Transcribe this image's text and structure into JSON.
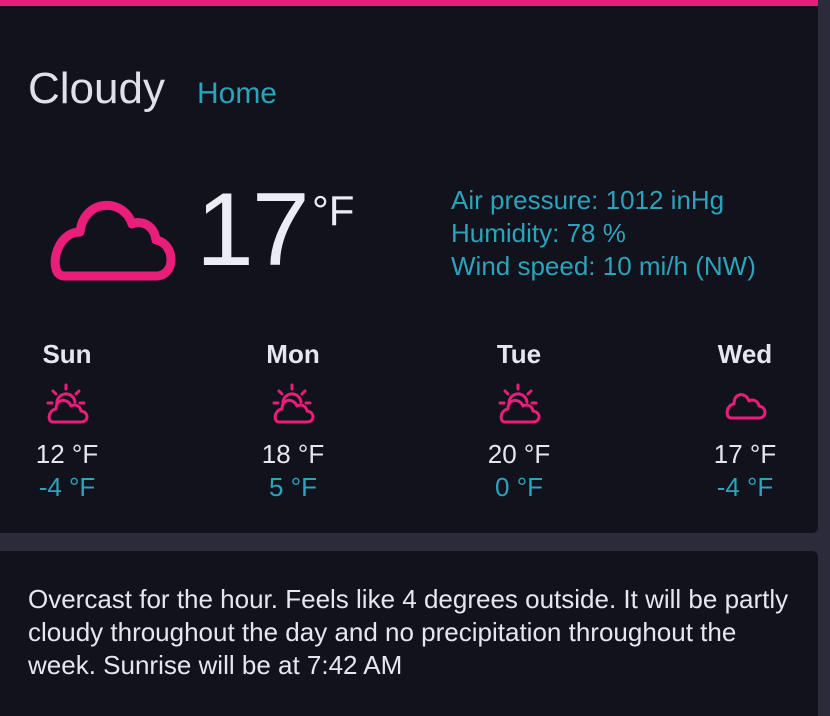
{
  "current": {
    "condition": "Cloudy",
    "location": "Home",
    "temperature": "17",
    "unit": "°F",
    "icon": "cloud-icon",
    "air_pressure": "Air pressure: 1012 inHg",
    "humidity": "Humidity: 78 %",
    "wind_speed": "Wind speed: 10 mi/h (NW)"
  },
  "forecast": [
    {
      "day": "Sun",
      "icon": "partly-cloudy-icon",
      "high": "12 °F",
      "low": "-4 °F"
    },
    {
      "day": "Mon",
      "icon": "partly-cloudy-icon",
      "high": "18 °F",
      "low": "5 °F"
    },
    {
      "day": "Tue",
      "icon": "partly-cloudy-icon",
      "high": "20 °F",
      "low": "0 °F"
    },
    {
      "day": "Wed",
      "icon": "cloud-icon",
      "high": "17 °F",
      "low": "-4 °F"
    }
  ],
  "summary": "Overcast for the hour. Feels like 4 degrees outside. It will be partly cloudy throughout the day and no precipitation throughout the week. Sunrise will be at 7:42 AM",
  "colors": {
    "accent": "#e91e7a",
    "secondary_text": "#2aa3bb",
    "card_background": "#12121c",
    "page_background": "#2c2b3b"
  }
}
